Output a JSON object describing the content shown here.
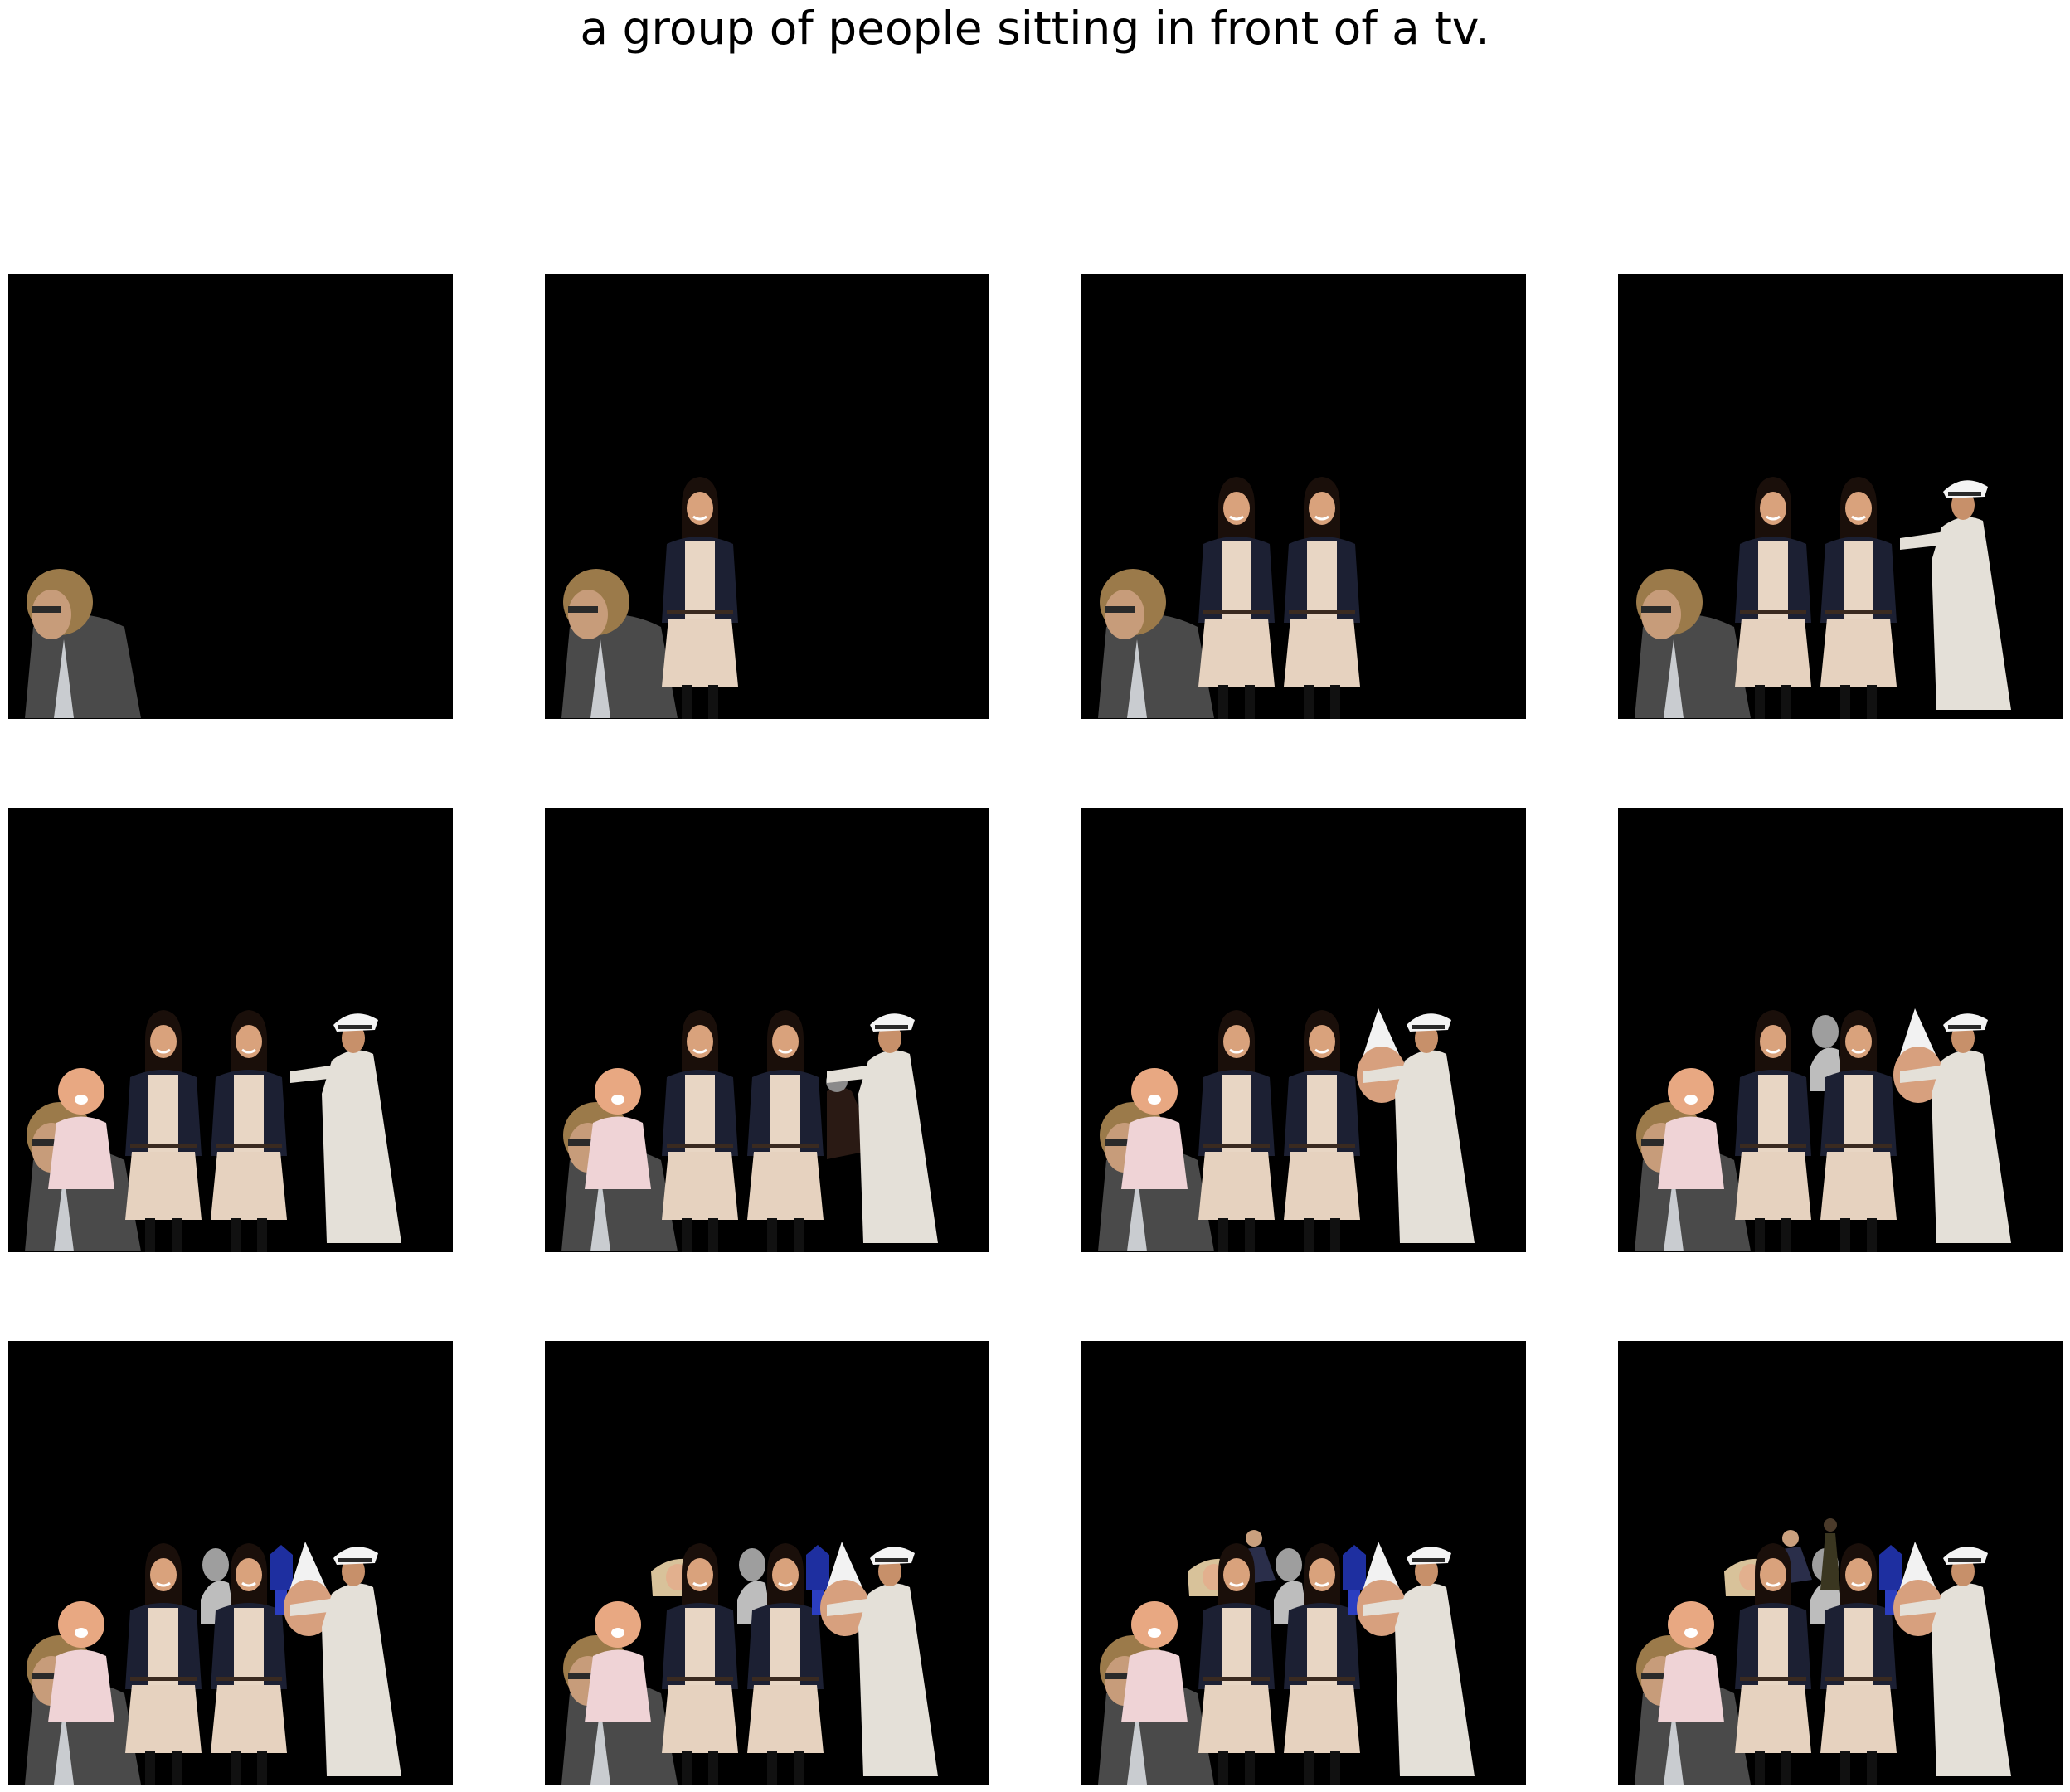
{
  "title": "a group of people sitting in front of a tv.",
  "panels": [
    {
      "figures": [
        "curly-haired-man"
      ]
    },
    {
      "figures": [
        "curly-haired-man",
        "smiling-woman-1"
      ]
    },
    {
      "figures": [
        "curly-haired-man",
        "smiling-woman-1",
        "smiling-woman-2"
      ]
    },
    {
      "figures": [
        "curly-haired-man",
        "smiling-woman-1",
        "smiling-woman-2",
        "naval-officer"
      ]
    },
    {
      "figures": [
        "curly-haired-man",
        "baby",
        "smiling-woman-1",
        "smiling-woman-2",
        "naval-officer"
      ]
    },
    {
      "figures": [
        "curly-haired-man",
        "baby",
        "smiling-woman-1",
        "smiling-woman-2",
        "small-man",
        "naval-officer"
      ]
    },
    {
      "figures": [
        "curly-haired-man",
        "baby",
        "smiling-woman-1",
        "smiling-woman-2",
        "party-hat-face",
        "naval-officer"
      ]
    },
    {
      "figures": [
        "curly-haired-man",
        "baby",
        "smiling-woman-1",
        "bw-man",
        "smiling-woman-2",
        "party-hat-face",
        "naval-officer"
      ]
    },
    {
      "figures": [
        "curly-haired-man",
        "baby",
        "smiling-woman-1",
        "bw-man",
        "smiling-woman-2",
        "blue-figure",
        "party-hat-face",
        "naval-officer"
      ]
    },
    {
      "figures": [
        "curly-haired-man",
        "baby",
        "blonde-woman",
        "smiling-woman-1",
        "bw-man",
        "smiling-woman-2",
        "blue-figure",
        "party-hat-face",
        "naval-officer"
      ]
    },
    {
      "figures": [
        "curly-haired-man",
        "baby",
        "blonde-woman",
        "seated-man",
        "smiling-woman-1",
        "bw-man",
        "smiling-woman-2",
        "blue-figure",
        "party-hat-face",
        "naval-officer"
      ]
    },
    {
      "figures": [
        "curly-haired-man",
        "baby",
        "blonde-woman",
        "seated-man",
        "smiling-woman-1",
        "bw-man",
        "dark-figure",
        "smiling-woman-2",
        "blue-figure",
        "party-hat-face",
        "naval-officer"
      ]
    }
  ]
}
